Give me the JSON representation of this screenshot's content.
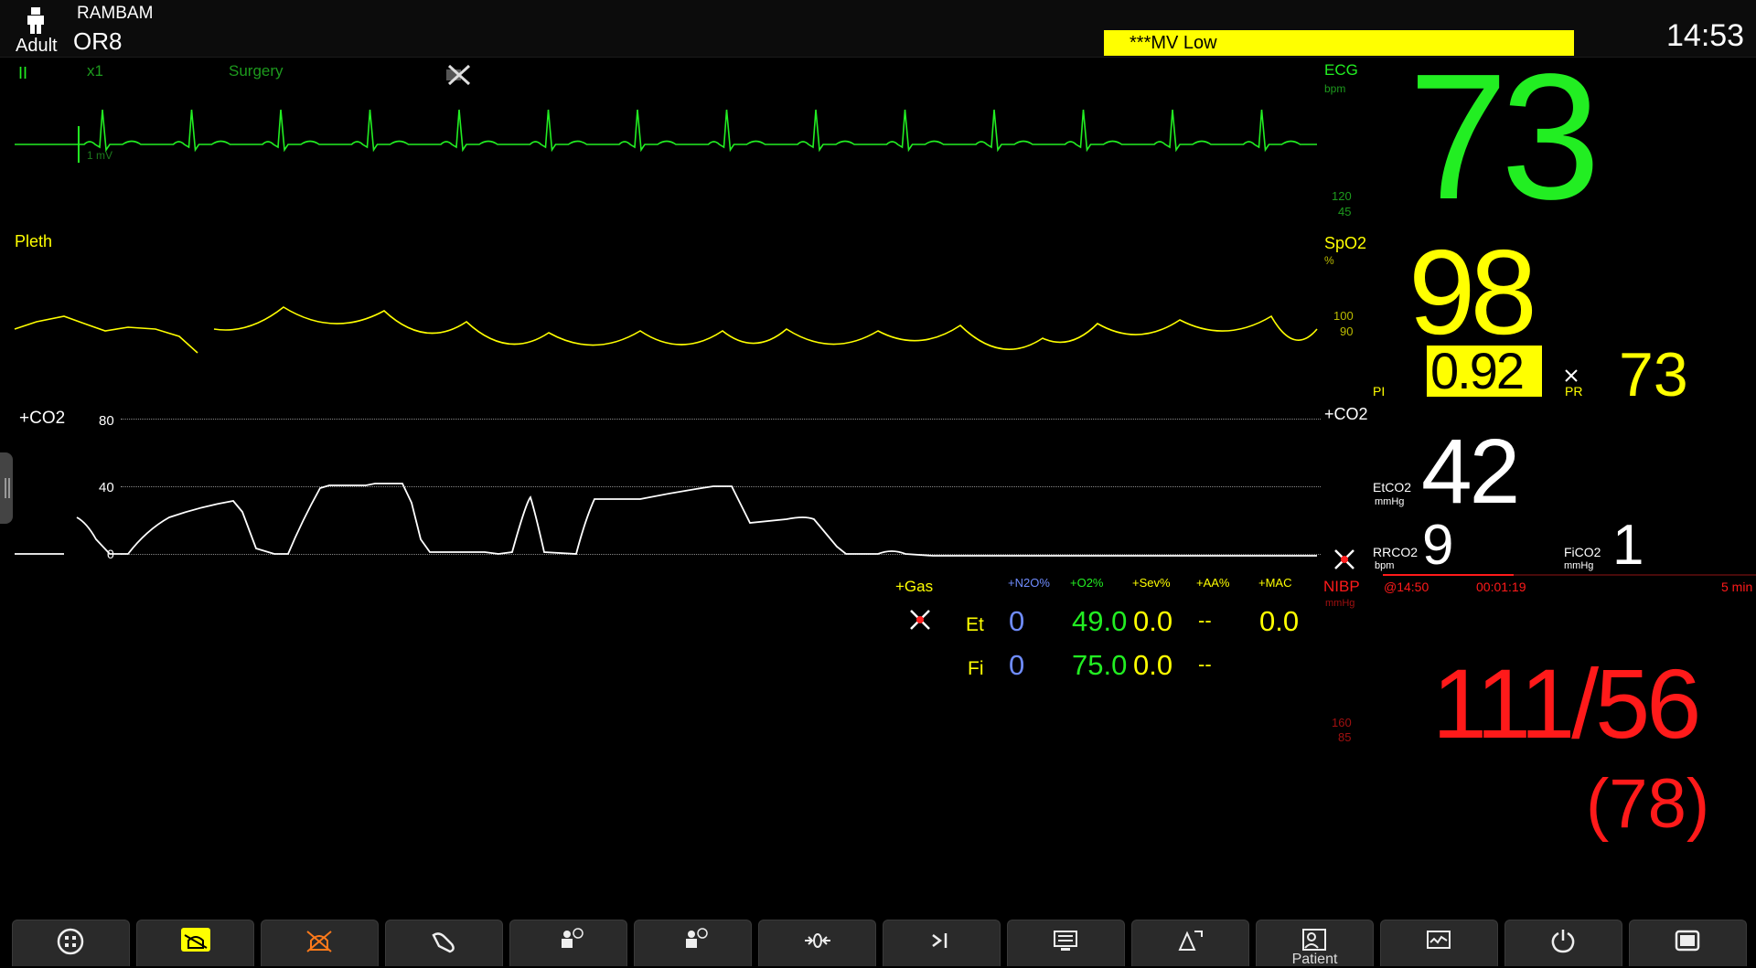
{
  "header": {
    "hospital": "RAMBAM",
    "patient_type": "Adult",
    "bed": "OR8",
    "alarm_message": "***MV Low",
    "time": "14:53"
  },
  "ecg": {
    "lead": "II",
    "gain": "x1",
    "filter": "Surgery",
    "scale_label": "1 mV",
    "label": "ECG",
    "unit": "bpm",
    "value": "73",
    "alarm_high": "120",
    "alarm_low": "45"
  },
  "pleth": {
    "wave_label": "Pleth",
    "label": "SpO2",
    "unit": "%",
    "value": "98",
    "alarm_high": "100",
    "alarm_low": "90",
    "pi_label": "PI",
    "pi_value": "0.92",
    "pr_label": "PR",
    "pr_value": "73"
  },
  "co2": {
    "wave_label": "+CO2",
    "scale_80": "80",
    "scale_40": "40",
    "scale_0": "0",
    "label": "+CO2",
    "etco2_label": "EtCO2",
    "etco2_unit": "mmHg",
    "etco2_value": "42",
    "rrco2_label": "RRCO2",
    "rrco2_unit": "bpm",
    "rrco2_value": "9",
    "fico2_label": "FiCO2",
    "fico2_unit": "mmHg",
    "fico2_value": "1"
  },
  "gas": {
    "label": "+Gas",
    "columns": [
      "+N2O%",
      "+O2%",
      "+Sev%",
      "+AA%",
      "+MAC"
    ],
    "rows": [
      {
        "name": "Et",
        "n2o": "0",
        "o2": "49.0",
        "sev": "0.0",
        "aa": "--",
        "mac": "0.0"
      },
      {
        "name": "Fi",
        "n2o": "0",
        "o2": "75.0",
        "sev": "0.0",
        "aa": "--"
      }
    ]
  },
  "nibp": {
    "label": "NIBP",
    "unit": "mmHg",
    "measured_at": "@14:50",
    "elapsed": "00:01:19",
    "interval": "5 min",
    "progress": 0.35,
    "alarm_high": "160",
    "alarm_low": "85",
    "value": "111/56",
    "mean": "(78)"
  },
  "toolbar": {
    "buttons": [
      {
        "label": "",
        "icon": "main-menu-icon"
      },
      {
        "label": "",
        "icon": "alarm-reset-icon"
      },
      {
        "label": "",
        "icon": "alarm-pause-icon"
      },
      {
        "label": "",
        "icon": "nibp-start-icon"
      },
      {
        "label": "",
        "icon": "nibp-measure-icon"
      },
      {
        "label": "",
        "icon": "nibp-stat-icon"
      },
      {
        "label": "",
        "icon": "zero-ibp-icon"
      },
      {
        "label": "",
        "icon": "manual-event-icon"
      },
      {
        "label": "",
        "icon": "screen-icon"
      },
      {
        "label": "",
        "icon": "alarm-setup-icon"
      },
      {
        "label": "Patient",
        "icon": "patient-icon"
      },
      {
        "label": "",
        "icon": "review-icon"
      },
      {
        "label": "",
        "icon": "standby-icon"
      },
      {
        "label": "",
        "icon": "display-icon"
      }
    ]
  },
  "colors": {
    "ecg": "#22ee22",
    "spo2": "#ffff00",
    "co2": "#ffffff",
    "nibp": "#ff1a1a",
    "n2o": "#6f8cff",
    "alarm_bg": "#ffff00"
  }
}
